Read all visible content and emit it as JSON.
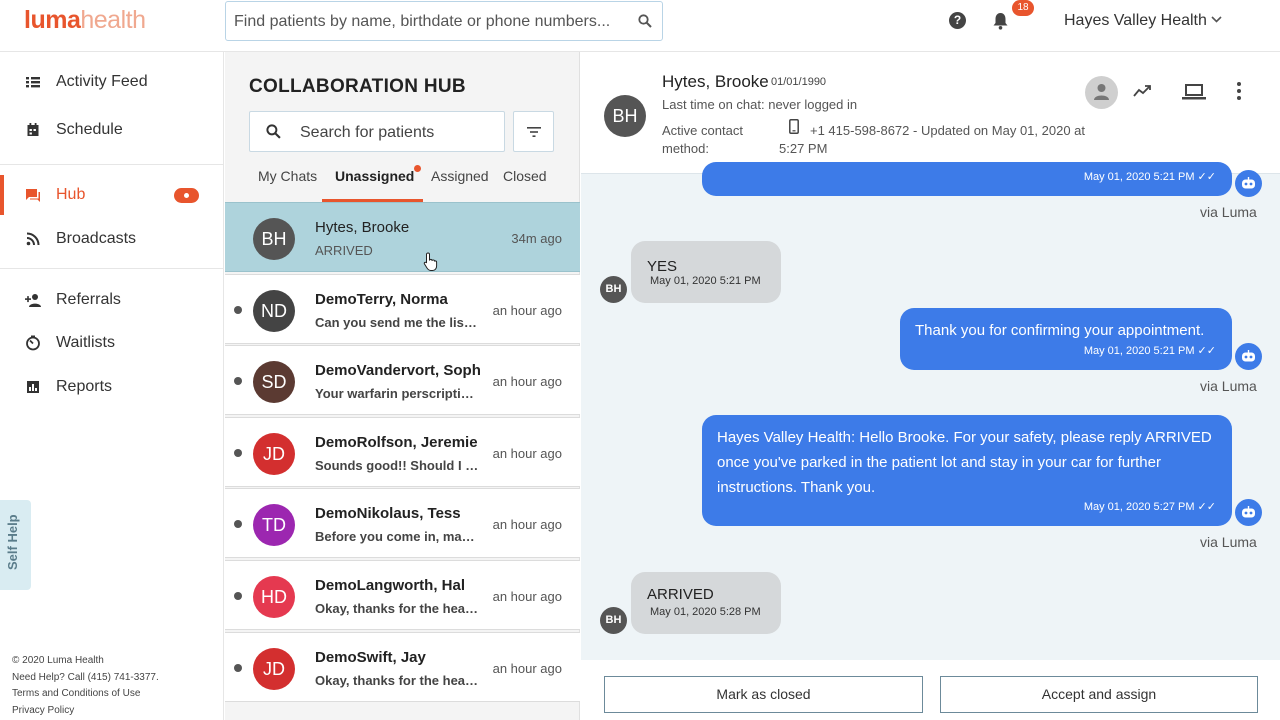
{
  "brand": {
    "part1": "luma",
    "part2": "health"
  },
  "header": {
    "search_placeholder": "Find patients by name, birthdate or phone numbers...",
    "notification_count": "18",
    "org_name": "Hayes Valley Health"
  },
  "sidebar": {
    "items": [
      {
        "label": "Activity Feed",
        "icon": "list-icon"
      },
      {
        "label": "Schedule",
        "icon": "calendar-icon"
      },
      {
        "label": "Hub",
        "icon": "chat-icon"
      },
      {
        "label": "Broadcasts",
        "icon": "rss-icon"
      },
      {
        "label": "Referrals",
        "icon": "person-add-icon"
      },
      {
        "label": "Waitlists",
        "icon": "timer-icon"
      },
      {
        "label": "Reports",
        "icon": "bar-chart-icon"
      }
    ],
    "self_help": "Self Help",
    "footer": {
      "copyright": "© 2020 Luma Health",
      "help": "Need Help? Call (415) 741-3377.",
      "terms": "Terms and Conditions of Use",
      "privacy": "Privacy Policy"
    }
  },
  "hub": {
    "title": "COLLABORATION HUB",
    "search_placeholder": "Search for patients",
    "tabs": [
      "My Chats",
      "Unassigned",
      "Assigned",
      "Closed"
    ],
    "active_tab": "Unassigned",
    "chats": [
      {
        "initials": "BH",
        "name": "Hytes, Brooke",
        "preview": "ARRIVED",
        "time": "34m ago",
        "color": "#555555",
        "unread": false
      },
      {
        "initials": "ND",
        "name": "DemoTerry, Norma",
        "preview": "Can you send me the list of...",
        "time": "an hour ago",
        "color": "#444444",
        "unread": true
      },
      {
        "initials": "SD",
        "name": "DemoVandervort, Sophia",
        "preview": "Your warfarin perscription is...",
        "time": "an hour ago",
        "color": "#5b3a32",
        "unread": true
      },
      {
        "initials": "JD",
        "name": "DemoRolfson, Jeremie",
        "preview": "Sounds good!! Should I bring...",
        "time": "an hour ago",
        "color": "#d32f2f",
        "unread": true
      },
      {
        "initials": "TD",
        "name": "DemoNikolaus, Tess",
        "preview": "Before you come in, make sure...",
        "time": "an hour ago",
        "color": "#9c27b0",
        "unread": true
      },
      {
        "initials": "HD",
        "name": "DemoLangworth, Hal",
        "preview": "Okay, thanks for the heads up...",
        "time": "an hour ago",
        "color": "#e53950",
        "unread": true
      },
      {
        "initials": "JD",
        "name": "DemoSwift, Jay",
        "preview": "Okay, thanks for the heads up...",
        "time": "an hour ago",
        "color": "#d32f2f",
        "unread": true
      }
    ]
  },
  "chat": {
    "patient_name": "Hytes, Brooke",
    "initials": "BH",
    "dob": "01/01/1990",
    "last_time": "Last time on chat: never logged in",
    "contact_label": "Active contact method:",
    "contact_value": "+1 415-598-8672 - Updated on May 01, 2020 at 5:27 PM",
    "messages": [
      {
        "direction": "out",
        "text": "",
        "time": "May 01, 2020 5:21 PM ✓✓",
        "via": "via Luma"
      },
      {
        "direction": "in",
        "text": "YES",
        "time": "May 01, 2020 5:21 PM"
      },
      {
        "direction": "out",
        "text": "Thank you for confirming your appointment.",
        "time": "May 01, 2020 5:21 PM ✓✓",
        "via": "via Luma"
      },
      {
        "direction": "out",
        "text": "Hayes Valley Health: Hello Brooke. For your safety, please reply ARRIVED once you've parked in the patient lot and stay in your car for further instructions. Thank you.",
        "time": "May 01, 2020 5:27 PM ✓✓",
        "via": "via Luma"
      },
      {
        "direction": "in",
        "text": "ARRIVED",
        "time": "May 01, 2020 5:28 PM"
      }
    ],
    "mark_closed": "Mark as closed",
    "accept_assign": "Accept and assign"
  },
  "colors": {
    "accent": "#e8552d",
    "bubble_out": "#3d7be8",
    "selected_row": "#aed3dc"
  }
}
